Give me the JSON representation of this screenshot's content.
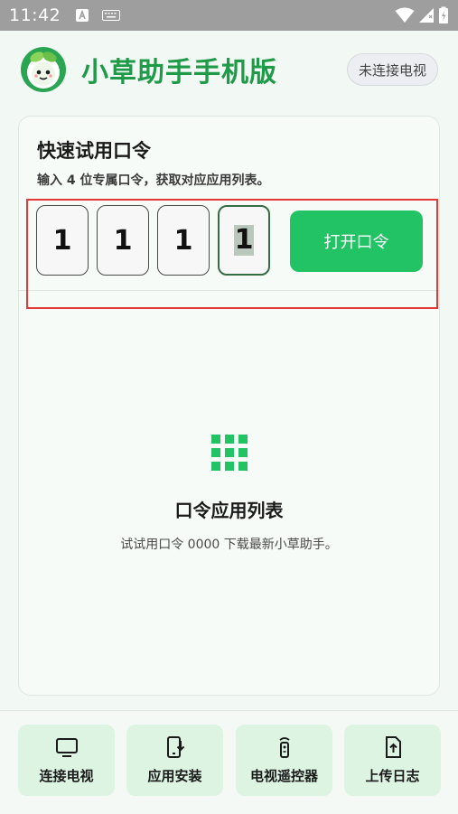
{
  "status": {
    "time": "11:42"
  },
  "header": {
    "title": "小草助手手机版",
    "connection": "未连接电视"
  },
  "card": {
    "title": "快速试用口令",
    "subtitle": "输入 4 位专属口令，获取对应应用列表。",
    "code_digits": [
      "1",
      "1",
      "1",
      "1"
    ],
    "open_button": "打开口令"
  },
  "empty_state": {
    "title": "口令应用列表",
    "description": "试试用口令 0000 下载最新小草助手。"
  },
  "toolbar": {
    "items": [
      {
        "label": "连接电视",
        "icon": "tv-icon"
      },
      {
        "label": "应用安装",
        "icon": "app-install-icon"
      },
      {
        "label": "电视遥控器",
        "icon": "remote-icon"
      },
      {
        "label": "上传日志",
        "icon": "upload-log-icon"
      }
    ]
  },
  "colors": {
    "brand_green": "#1f9a48",
    "button_green": "#22c364",
    "highlight_red": "#e53935"
  }
}
